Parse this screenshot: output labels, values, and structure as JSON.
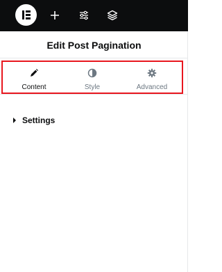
{
  "topbar": {
    "logo_icon": "elementor-logo-icon",
    "add_icon": "plus-icon",
    "settings_icon": "sliders-icon",
    "structure_icon": "layers-icon"
  },
  "panel": {
    "title": "Edit Post Pagination"
  },
  "tabs": [
    {
      "label": "Content",
      "icon": "pencil-icon",
      "active": true
    },
    {
      "label": "Style",
      "icon": "half-circle-icon",
      "active": false
    },
    {
      "label": "Advanced",
      "icon": "gear-icon",
      "active": false
    }
  ],
  "highlight_color": "#e8161e",
  "sections": [
    {
      "label": "Settings",
      "expanded": false
    }
  ]
}
